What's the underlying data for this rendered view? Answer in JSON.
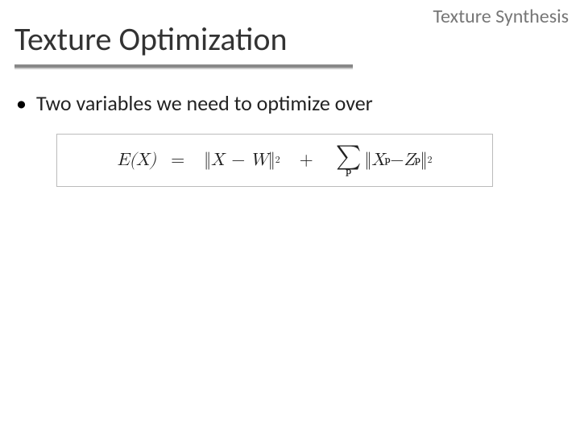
{
  "header": {
    "label": "Texture Synthesis"
  },
  "title": "Texture Optimization",
  "bullets": [
    "Two variables we need to optimize over"
  ],
  "equation": {
    "lhs": "E(X)",
    "eq": "=",
    "term1_open": "‖",
    "term1_body": "X − W",
    "term1_close": "‖",
    "sq": "2",
    "plus": "+",
    "sigma": "∑",
    "sigma_sub": "p",
    "term2_open": "‖",
    "term2_a": "X",
    "term2_sub": "p",
    "term2_minus": " − ",
    "term2_b": "Z",
    "term2_close": "‖"
  }
}
